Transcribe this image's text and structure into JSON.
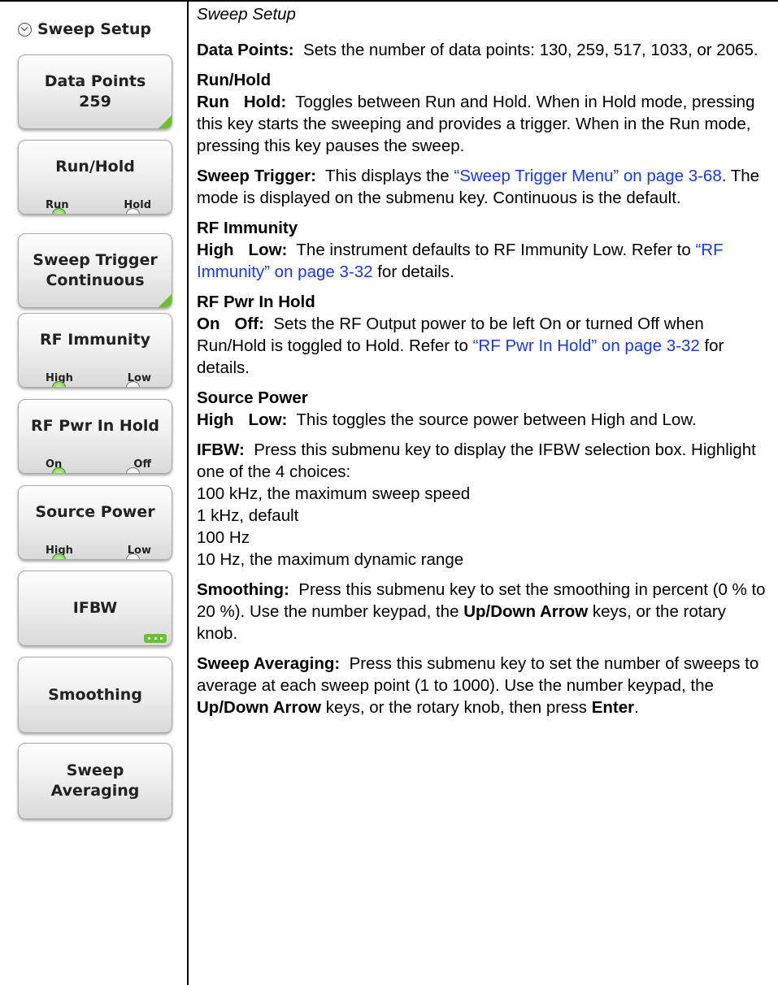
{
  "menu": {
    "title": "Sweep Setup",
    "keys": [
      {
        "label": "Data Points",
        "value": "259"
      },
      {
        "label": "Run/Hold",
        "opt1": "Run",
        "opt2": "Hold"
      },
      {
        "label": "Sweep Trigger",
        "value": "Continuous"
      },
      {
        "label": "RF Immunity",
        "opt1": "High",
        "opt2": "Low"
      },
      {
        "label": "RF Pwr In Hold",
        "opt1": "On",
        "opt2": "Off"
      },
      {
        "label": "Source Power",
        "opt1": "High",
        "opt2": "Low"
      },
      {
        "label": "IFBW"
      },
      {
        "label": "Smoothing"
      },
      {
        "label": "Sweep",
        "label2": "Averaging"
      }
    ]
  },
  "desc": {
    "section_title": "Sweep Setup",
    "data_points": {
      "term": "Data Points:",
      "text": "Sets the number of data points: 130, 259, 517, 1033, or 2065."
    },
    "run_hold": {
      "heading": "Run/Hold",
      "opt1": "Run",
      "opt2": "Hold:",
      "text": "Toggles between Run and Hold. When in Hold mode, pressing this key starts the sweeping and provides a trigger. When in the Run mode, pressing this key pauses the sweep."
    },
    "sweep_trigger": {
      "term": "Sweep Trigger:",
      "text1": "This displays the",
      "link": "“Sweep Trigger Menu” on page 3-68",
      "text2": ". The mode is displayed on the submenu key. Continuous is the default."
    },
    "rf_immunity": {
      "heading": "RF Immunity",
      "opt1": "High",
      "opt2": "Low:",
      "text1": "The instrument defaults to RF Immunity Low. Refer to",
      "link": "“RF Immunity” on page 3-32",
      "text2": "for details."
    },
    "rf_pwr": {
      "heading": "RF Pwr In Hold",
      "opt1": "On",
      "opt2": "Off:",
      "text1": "Sets the RF Output power to be left On or turned Off when Run/Hold is toggled to Hold. Refer to",
      "link": "“RF Pwr In Hold” on page 3-32",
      "text2": "for details."
    },
    "source_power": {
      "heading": "Source Power",
      "opt1": "High",
      "opt2": "Low:",
      "text": "This toggles the source power between High and Low."
    },
    "ifbw": {
      "term": "IFBW:",
      "text": "Press this submenu key to display the IFBW selection box. Highlight one of the 4 choices:",
      "choices": [
        "100 kHz, the maximum sweep speed",
        "1 kHz, default",
        "100 Hz",
        "10 Hz, the maximum dynamic range"
      ]
    },
    "smoothing": {
      "term": "Smoothing:",
      "text1": "Press this submenu key to set the smoothing in percent (0 % to 20 %). Use the number keypad, the",
      "bold1": "Up/Down Arrow",
      "text2": "keys, or the rotary knob."
    },
    "sweep_avg": {
      "term": "Sweep Averaging:",
      "text1": "Press this submenu key to set the number of sweeps to average at each sweep point (1 to 1000). Use the number keypad, the",
      "bold1": "Up/Down Arrow",
      "text2": "keys, or the rotary knob, then press",
      "bold2": "Enter",
      "text3": "."
    }
  }
}
